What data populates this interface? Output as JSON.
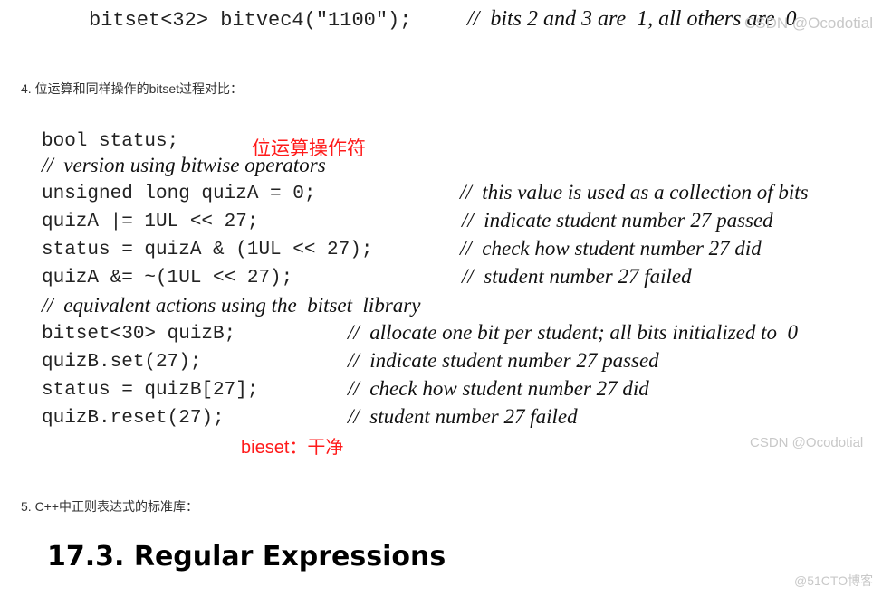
{
  "top_snippet": {
    "code": "bitset<32> bitvec4(\"1100\");",
    "comment": "//  bits 2 and 3 are  1, all others are  0"
  },
  "section4": {
    "label": "4. 位运算和同样操作的bitset过程对比："
  },
  "code_image": {
    "lines": [
      {
        "code": "bool status;",
        "comment": ""
      },
      {
        "code": "",
        "comment": "//  version using bitwise operators"
      },
      {
        "code": "unsigned long quizA = 0;",
        "comment": "//  this value is used as a collection of bits"
      },
      {
        "code": "quizA |= 1UL << 27;",
        "comment": "//  indicate student number 27 passed"
      },
      {
        "code": "status = quizA & (1UL << 27);",
        "comment": "//  check how student number 27 did"
      },
      {
        "code": "quizA &= ~(1UL << 27);",
        "comment": "//  student number 27 failed"
      },
      {
        "code": "",
        "comment": "//  equivalent actions using the  bitset  library"
      },
      {
        "code": "bitset<30> quizB;",
        "comment": "//  allocate one bit per student; all bits initialized to  0"
      },
      {
        "code": "quizB.set(27);",
        "comment": "//  indicate student number 27 passed"
      },
      {
        "code": "status = quizB[27];",
        "comment": "//  check how student number 27 did"
      },
      {
        "code": "quizB.reset(27);",
        "comment": "//  student number 27 failed"
      }
    ],
    "annotation_top": "位运算操作符",
    "annotation_bottom": "bieset：干净",
    "annotation_color": "#ff1a1a"
  },
  "section5": {
    "label": "5. C++中正则表达式的标准库："
  },
  "heading_image": {
    "text": "17.3. Regular Expressions"
  },
  "watermarks": {
    "csdn_top": "CSDN @Ocodotial",
    "csdn_mid": "CSDN @Ocodotial",
    "cto": "@51CTO博客"
  }
}
